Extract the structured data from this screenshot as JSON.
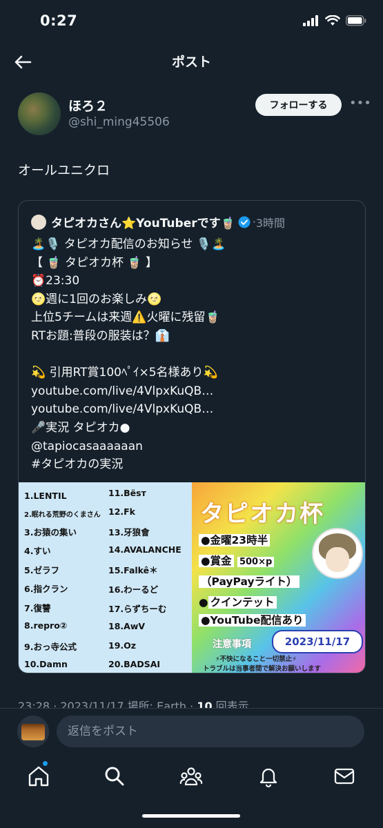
{
  "status_bar": {
    "time": "0:27"
  },
  "header": {
    "title": "ポスト"
  },
  "post": {
    "display_name": "ほろ２",
    "handle": "@shi_ming45506",
    "follow_label": "フォローする",
    "text": "オールユニクロ"
  },
  "quoted": {
    "name": "タピオカさん⭐YouTuberです🧋",
    "time": "3時間",
    "body": "🏝️🎙️ タピオカ配信のお知らせ 🎙️🏝️\n【 🧋 タピオカ杯 🧋 】\n⏰23:30\n🌝週に1回のお楽しみ🌝\n上位5チームは来週⚠️火曜に残留🧋\nRTお題:普段の服装は？👔\n\n💫 引用RT賞100ﾍﾟｲ×5名様あり💫\nyoutube.com/live/4VlpxKuQB…\nyoutube.com/live/4VlpxKuQB…\n🎤実況 タピオカ●\n@tapiocasaaaaaan\n#タピオカの実況",
    "image": {
      "teams_left": [
        "1.LENTIL",
        "2.眠れる荒野のくまさん",
        "3.お猿の集い",
        "4.すい",
        "5.ゼラフ",
        "6.指クラン",
        "7.復讐",
        "8.repro②",
        "9.おっ寺公式",
        "10.Damn"
      ],
      "teams_right": [
        "11.Bësт",
        "12.Fk",
        "13.牙狼會",
        "14.AVALANCHE",
        "15.Falkê＊",
        "16.わーるど",
        "17.らずちーむ",
        "18.AwV",
        "19.Oz",
        "20.BADSAI"
      ],
      "title": "タピオカ杯",
      "line1": "●金曜23時半",
      "line2_label": "●賞金",
      "line2_value": "500×p",
      "line3": "（PayPayライト）",
      "line4_dot": "●",
      "line4": "クインテット",
      "line5": "●YouTube配信あり",
      "date": "2023/11/17",
      "note_title": "注意事項",
      "note1": "⚡不快になること一切禁止⚡",
      "note2": "トラブルは当事者間で解決お願いします"
    }
  },
  "meta": {
    "datetime": "23:28 · 2023/11/17 場所: Earth · ",
    "views": "10",
    "views_suffix": " 回表示"
  },
  "reply": {
    "placeholder": "返信をポスト"
  },
  "tabs": [
    "home-icon",
    "search-icon",
    "communities-icon",
    "notifications-icon",
    "messages-icon"
  ],
  "colors": {
    "background": "#15202b",
    "accent": "#1d9bf0"
  }
}
